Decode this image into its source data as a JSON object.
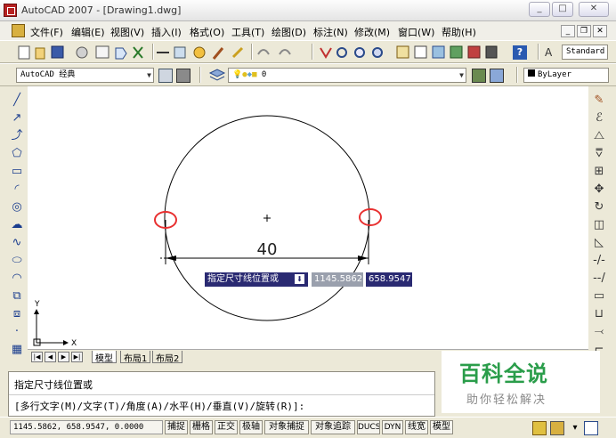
{
  "window": {
    "title": "AutoCAD 2007 - [Drawing1.dwg]",
    "minimize": "_",
    "maximize": "□",
    "close": "✕"
  },
  "menu": [
    "文件(F)",
    "编辑(E)",
    "视图(V)",
    "插入(I)",
    "格式(O)",
    "工具(T)",
    "绘图(D)",
    "标注(N)",
    "修改(M)",
    "窗口(W)",
    "帮助(H)"
  ],
  "toolbar": {
    "text_style": "Standard",
    "workspace": "AutoCAD 经典",
    "layer": "0",
    "color": "ByLayer"
  },
  "drawing": {
    "dimension_text": "40"
  },
  "dynamic_input": {
    "prompt": "指定尺寸线位置或",
    "x": "1145.5862",
    "y": "658.9547"
  },
  "layout_tabs": [
    "模型",
    "布局1",
    "布局2"
  ],
  "axis": {
    "x": "X",
    "y": "Y"
  },
  "command": {
    "line1": "指定尺寸线位置或",
    "line2": "[多行文字(M)/文字(T)/角度(A)/水平(H)/垂直(V)/旋转(R)]:"
  },
  "status": {
    "coords": "1145.5862, 658.9547, 0.0000",
    "buttons": [
      "捕捉",
      "栅格",
      "正交",
      "极轴",
      "对象捕捉",
      "对象追踪",
      "DUCS",
      "DYN",
      "线宽",
      "模型"
    ]
  },
  "watermark": {
    "title": "百科全说",
    "subtitle": "助你轻松解决"
  },
  "colors": {
    "highlight": "#e83030",
    "tooltip": "#2a2a72",
    "watermark": "#2a9d4a"
  }
}
